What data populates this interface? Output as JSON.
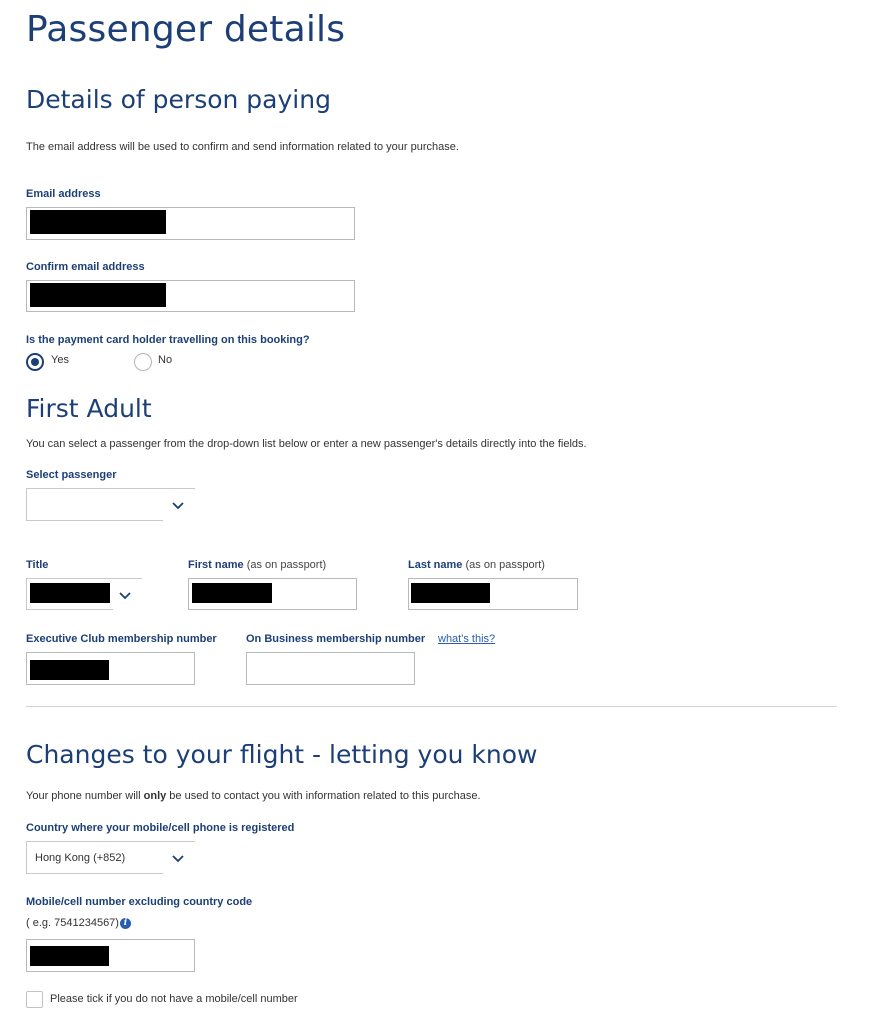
{
  "page": {
    "title": "Passenger details"
  },
  "payer": {
    "heading": "Details of person paying",
    "intro": "The email address will be used to confirm and send information related to your purchase.",
    "email_label": "Email address",
    "confirm_email_label": "Confirm email address",
    "cardholder_question": "Is the payment card holder travelling on this booking?",
    "cardholder_options": [
      {
        "label": "Yes",
        "selected": true
      },
      {
        "label": "No",
        "selected": false
      }
    ]
  },
  "adult": {
    "heading": "First Adult",
    "intro": "You can select a passenger from the drop-down list below or enter a new passenger's details directly into the fields.",
    "select_passenger_label": "Select passenger",
    "title_label": "Title",
    "first_name_label": "First name",
    "first_name_note": "(as on passport)",
    "last_name_label": "Last name",
    "last_name_note": "(as on passport)",
    "exec_club_label": "Executive Club membership number",
    "on_business_label": "On Business membership number",
    "whats_this_link": "what's this?"
  },
  "changes": {
    "heading": "Changes to your flight - letting you know",
    "intro_before": "Your phone number will ",
    "intro_bold": "only",
    "intro_after": " be used to contact you with information related to this purchase.",
    "country_label": "Country where your mobile/cell phone is registered",
    "country_value": "Hong Kong (+852)",
    "mobile_label": "Mobile/cell number excluding country code",
    "mobile_hint": "( e.g. 7541234567)",
    "info_icon": "i",
    "no_mobile_checkbox_label": "Please tick if you do not have a mobile/cell number"
  },
  "colors": {
    "heading": "#1c3f77",
    "link": "#2a5db0",
    "redaction": "#000000"
  },
  "icons": {
    "dropdown": "chevron-down-icon",
    "info": "info-icon"
  }
}
